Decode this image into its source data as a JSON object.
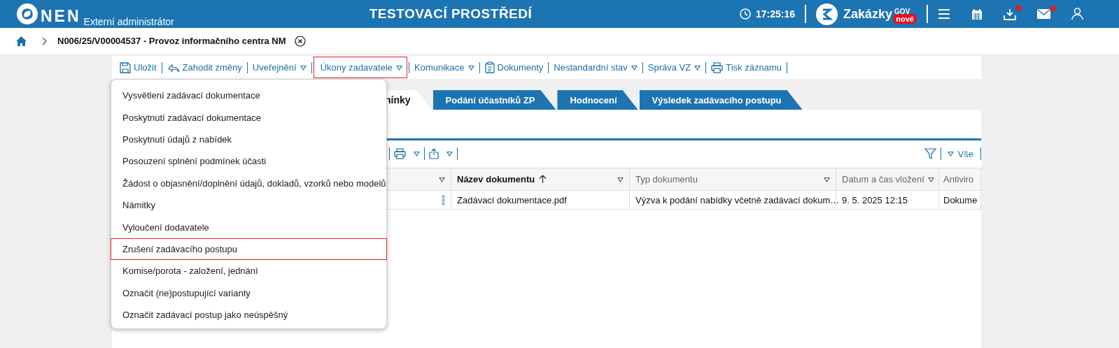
{
  "header": {
    "logo": "NEN",
    "role": "Externí administrátor",
    "environment": "TESTOVACÍ PROSTŘEDÍ",
    "time": "17:25:16",
    "brand": "Zakázky",
    "brand_sup": "GOV",
    "brand_badge": "nové",
    "icons": [
      {
        "kind": "menu",
        "notification": false
      },
      {
        "kind": "calendar",
        "notification": false
      },
      {
        "kind": "download",
        "notification": true
      },
      {
        "kind": "mail",
        "notification": true
      },
      {
        "kind": "user",
        "notification": false
      }
    ]
  },
  "breadcrumb": {
    "title": "N006/25/V00004537 - Provoz informačního centra NM"
  },
  "toolbar": [
    {
      "label": "Uložit",
      "dropdown": false,
      "highlighted": false
    },
    {
      "label": "Zahodit změny",
      "dropdown": false,
      "highlighted": false
    },
    {
      "label": "Uveřejnění",
      "dropdown": true,
      "highlighted": false
    },
    {
      "label": "Úkony zadavatele",
      "dropdown": true,
      "highlighted": true
    },
    {
      "label": "Komunikace",
      "dropdown": true,
      "highlighted": false
    },
    {
      "label": "Dokumenty",
      "dropdown": false,
      "highlighted": false
    },
    {
      "label": "Nestandardní stav",
      "dropdown": true,
      "highlighted": false
    },
    {
      "label": "Správa VZ",
      "dropdown": true,
      "highlighted": false
    },
    {
      "label": "Tisk záznamu",
      "dropdown": false,
      "highlighted": false
    }
  ],
  "menu": [
    {
      "label": "Vysvětlení zadávací dokumentace",
      "highlighted": false
    },
    {
      "label": "Poskytnutí zadávací dokumentace",
      "highlighted": false
    },
    {
      "label": "Poskytnutí údajů z nabídek",
      "highlighted": false
    },
    {
      "label": "Posouzení splnění podmínek účasti",
      "highlighted": false
    },
    {
      "label": "Žádost o objasnění/doplnění údajů, dokladů, vzorků nebo modelů",
      "highlighted": false
    },
    {
      "label": "Námitky",
      "highlighted": false
    },
    {
      "label": "Vyloučení dodavatele",
      "highlighted": false
    },
    {
      "label": "Zrušení zadávacího postupu",
      "highlighted": true
    },
    {
      "label": "Komise/porota - založení, jednání",
      "highlighted": false
    },
    {
      "label": "Označit (ne)postupující varianty",
      "highlighted": false
    },
    {
      "label": "Označit zadávací postup jako neúspěšný",
      "highlighted": false
    }
  ],
  "tabs": [
    {
      "label": "nínky",
      "selected": true
    },
    {
      "label": "Podání účastníků ZP",
      "selected": false
    },
    {
      "label": "Hodnocení",
      "selected": false
    },
    {
      "label": "Výsledek zadávacího postupu",
      "selected": false
    }
  ],
  "grid_toolbar": {
    "filter_label": "Vše"
  },
  "table": {
    "columns": [
      {
        "label": "Název dokumentu",
        "sorted": true
      },
      {
        "label": "Typ dokumentu",
        "sorted": false
      },
      {
        "label": "Datum a čas vložení",
        "sorted": false
      },
      {
        "label": "Antiviro",
        "sorted": false
      }
    ],
    "rows": [
      [
        "Zadávací dokumentace.pdf",
        "Výzva k podání nabídky včetně zadávací dokum…",
        "9. 5. 2025 12:15",
        "Dokume"
      ]
    ]
  }
}
